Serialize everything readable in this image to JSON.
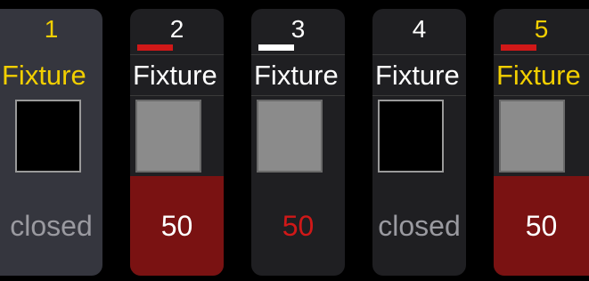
{
  "colors": {
    "accent_yellow": "#f2cf00",
    "white": "#ffffff",
    "red_marker": "#d01818",
    "white_marker": "#ffffff",
    "value_fill_red": "#7a1212",
    "value_text_red": "#d01818",
    "value_text_grey": "#9a9aa0"
  },
  "fixtures": [
    {
      "id": "1",
      "name": "Fixture",
      "state": "closed"
    },
    {
      "id": "2",
      "name": "Fixture",
      "state": "50"
    },
    {
      "id": "3",
      "name": "Fixture",
      "state": "50"
    },
    {
      "id": "4",
      "name": "Fixture",
      "state": "closed"
    },
    {
      "id": "5",
      "name": "Fixture",
      "state": "50"
    }
  ]
}
